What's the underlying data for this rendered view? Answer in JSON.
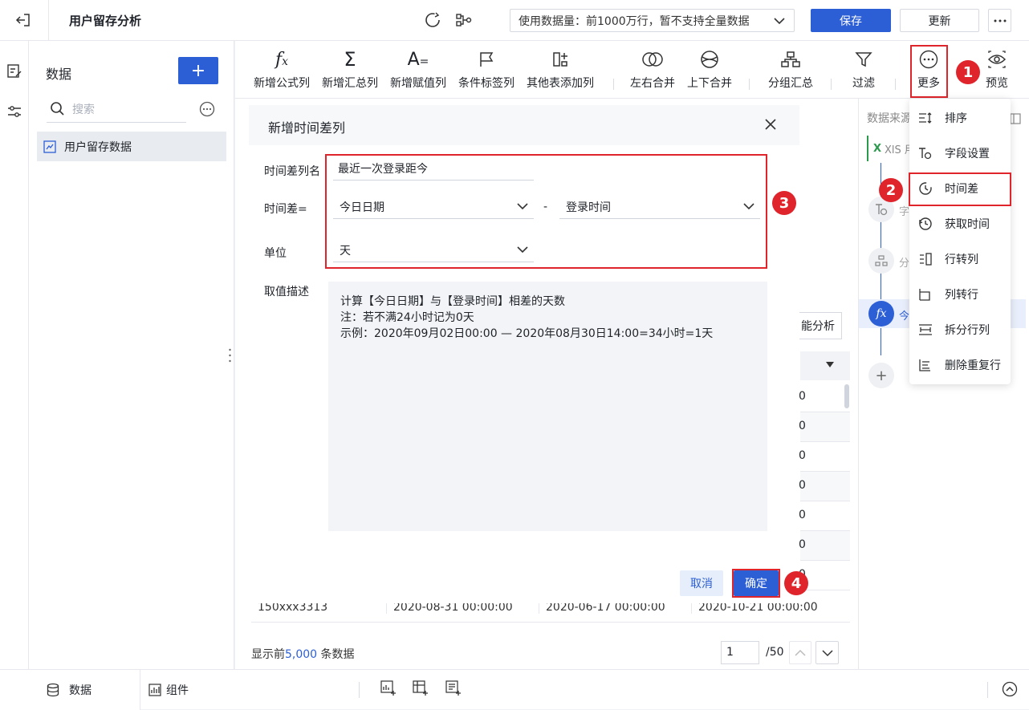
{
  "app": {
    "title": "用户留存分析",
    "data_volume": "使用数据量：前1000万行，暂不支持全量数据",
    "save": "保存",
    "update": "更新"
  },
  "sidebar": {
    "title": "数据",
    "search_placeholder": "搜索",
    "items": [
      {
        "label": "用户留存数据"
      }
    ]
  },
  "toolbar": {
    "items": [
      {
        "label": "新增公式列",
        "icon": "fx-icon"
      },
      {
        "label": "新增汇总列",
        "icon": "sigma-icon"
      },
      {
        "label": "新增赋值列",
        "icon": "assign-icon"
      },
      {
        "label": "条件标签列",
        "icon": "flag-icon"
      },
      {
        "label": "其他表添加列",
        "icon": "add-column-icon"
      },
      {
        "label": "左右合并",
        "icon": "merge-lr-icon"
      },
      {
        "label": "上下合并",
        "icon": "merge-ud-icon"
      },
      {
        "label": "分组汇总",
        "icon": "group-icon"
      },
      {
        "label": "过滤",
        "icon": "filter-icon"
      },
      {
        "label": "更多",
        "icon": "more-icon"
      },
      {
        "label": "预览",
        "icon": "eye-icon"
      }
    ]
  },
  "more_menu": {
    "items": [
      {
        "label": "排序"
      },
      {
        "label": "字段设置"
      },
      {
        "label": "时间差"
      },
      {
        "label": "获取时间"
      },
      {
        "label": "行转列"
      },
      {
        "label": "列转行"
      },
      {
        "label": "拆分行列"
      },
      {
        "label": "删除重复行"
      }
    ]
  },
  "right_panel": {
    "title": "数据来源",
    "steps": [
      "XlS 用户",
      "字",
      "分",
      "今"
    ]
  },
  "dialog": {
    "title": "新增时间差列",
    "name_label": "时间差列名",
    "name_value": "最近一次登录距今",
    "diff_label": "时间差=",
    "diff_left": "今日日期",
    "minus": "-",
    "diff_right": "登录时间",
    "unit_label": "单位",
    "unit_value": "天",
    "desc_label": "取值描述",
    "desc_lines": [
      "计算【今日日期】与【登录时间】相差的天数",
      "注：若不满24小时记为0天",
      "示例：2020年09月02日00:00 — 2020年08月30日14:00=34小时=1天"
    ],
    "cancel": "取消",
    "confirm": "确定"
  },
  "table": {
    "analysis_button": "能分析",
    "visible_cells": [
      "0",
      "0",
      "0",
      "0",
      "0",
      "0",
      "0"
    ],
    "last_row": [
      "150xxx3313",
      "2020-08-31 00:00:00",
      "2020-06-17 00:00:00",
      "2020-10-21 00:00:00"
    ],
    "footer_prefix": "显示前",
    "footer_count": "5,000",
    "footer_suffix": "条数据",
    "page": "1",
    "page_total": "/50"
  },
  "badges": [
    "1",
    "2",
    "3",
    "4"
  ],
  "bottom": {
    "tab_data": "数据",
    "tab_component": "组件"
  },
  "colors": {
    "primary": "#2c5fd6",
    "red": "#e0242b"
  }
}
